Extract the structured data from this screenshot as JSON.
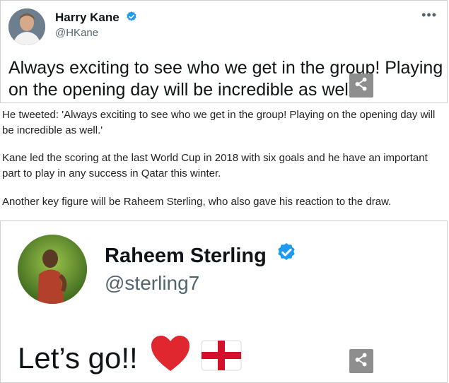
{
  "tweet1": {
    "name": "Harry Kane",
    "handle": "@HKane",
    "more": "•••",
    "text": "Always exciting to see who we get in the group! Playing on the opening day will be incredible as well"
  },
  "article": {
    "para1": "He tweeted: 'Always exciting to see who we get in the group! Playing on the opening day will be incredible as well.'",
    "para2": "Kane led the scoring at the last World Cup in 2018 with six goals and he have an important part to play in any success in Qatar this winter.",
    "para3": "Another key figure will be Raheem Sterling, who also gave his reaction to the draw."
  },
  "tweet2": {
    "name": "Raheem Sterling",
    "handle": "@sterling7",
    "text": "Let’s go!!"
  },
  "icons": {
    "verified": "verified-badge-icon",
    "share": "share-icon",
    "heart": "red-heart-emoji",
    "flag": "england-flag-emoji"
  },
  "colors": {
    "verified": "#1d9bf0",
    "handle": "#536471",
    "share_bg": "#8e8e8e",
    "heart": "#e0262f",
    "flag_cross": "#d4102a"
  }
}
